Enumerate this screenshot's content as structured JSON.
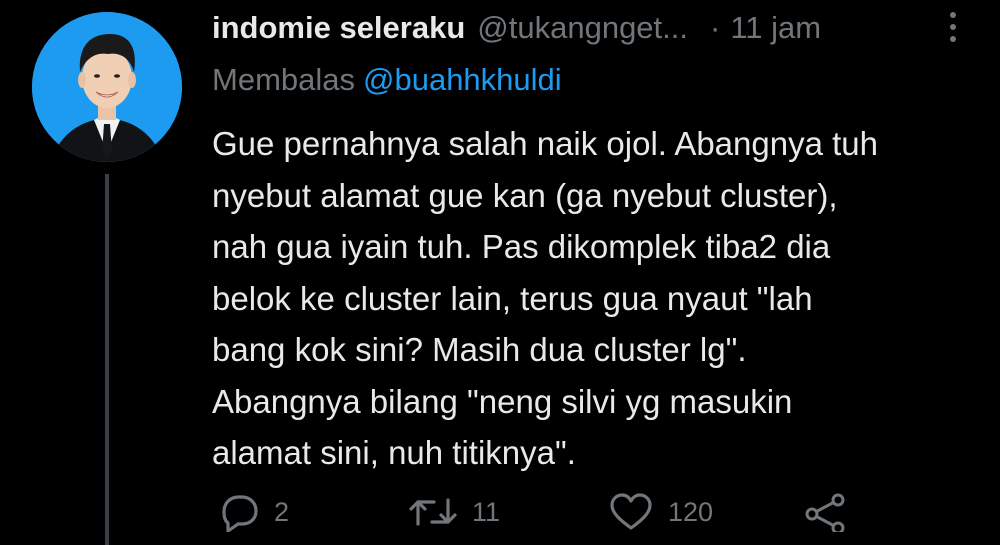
{
  "tweet": {
    "display_name": "indomie seleraku",
    "handle": "@tukangnget...",
    "separator": "·",
    "time": "11 jam",
    "reply_prefix": "Membalas",
    "reply_to": "@buahhkhuldi",
    "text_lines": [
      "Gue pernahnya salah naik ojol. Abangnya tuh",
      "nyebut alamat gue kan (ga nyebut cluster),",
      "nah gua iyain tuh. Pas dikomplek tiba2 dia",
      "belok ke cluster lain, terus gua nyaut \"lah",
      "bang kok sini? Masih dua cluster lg\".",
      "Abangnya bilang \"neng silvi yg masukin",
      "alamat sini, nuh titiknya\"."
    ]
  },
  "actions": {
    "reply_count": "2",
    "retweet_count": "11",
    "like_count": "120"
  },
  "icons": {
    "avatar": "avatar",
    "more": "more-vertical-icon",
    "reply": "reply-icon",
    "retweet": "retweet-icon",
    "like": "heart-icon",
    "share": "share-icon"
  },
  "colors": {
    "background": "#000000",
    "text": "#e7e9ea",
    "muted": "#71767b",
    "accent": "#1d9bf0"
  }
}
